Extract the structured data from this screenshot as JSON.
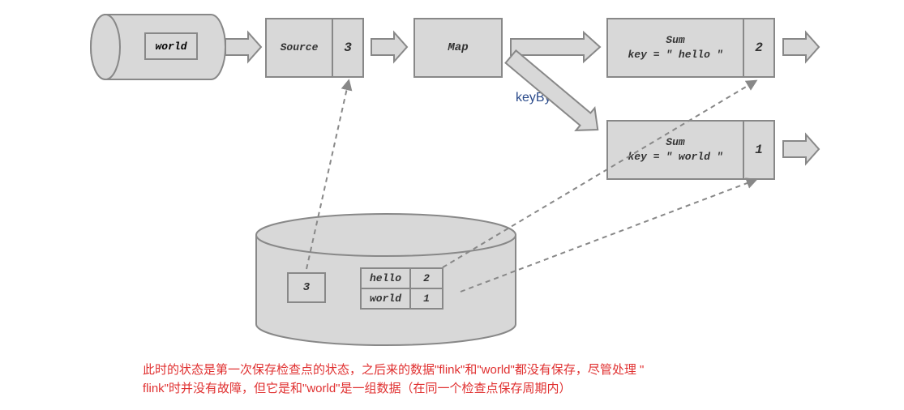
{
  "nodes": {
    "world": "world",
    "source": {
      "label": "Source",
      "value": "3"
    },
    "map": "Map",
    "sum1": {
      "title": "Sum",
      "expr": "key = \" hello \"",
      "value": "2"
    },
    "sum2": {
      "title": "Sum",
      "expr": "key = \" world \"",
      "value": "1"
    }
  },
  "keyby_label": "keyBy",
  "storage": {
    "offset": "3",
    "rows": [
      {
        "key": "hello",
        "val": "2"
      },
      {
        "key": "world",
        "val": "1"
      }
    ]
  },
  "caption_line1": "此时的状态是第一次保存检查点的状态，之后来的数据\"flink\"和\"world\"都没有保存，尽管处理 \"",
  "caption_line2": "flink\"时并没有故障，但它是和\"world\"是一组数据（在同一个检查点保存周期内）"
}
